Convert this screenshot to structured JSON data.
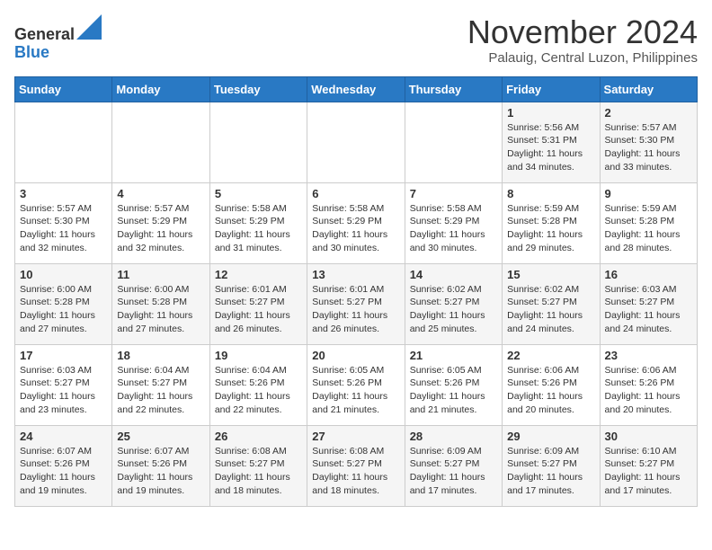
{
  "header": {
    "logo_line1": "General",
    "logo_line2": "Blue",
    "month_title": "November 2024",
    "location": "Palauig, Central Luzon, Philippines"
  },
  "weekdays": [
    "Sunday",
    "Monday",
    "Tuesday",
    "Wednesday",
    "Thursday",
    "Friday",
    "Saturday"
  ],
  "weeks": [
    [
      {
        "day": "",
        "info": ""
      },
      {
        "day": "",
        "info": ""
      },
      {
        "day": "",
        "info": ""
      },
      {
        "day": "",
        "info": ""
      },
      {
        "day": "",
        "info": ""
      },
      {
        "day": "1",
        "info": "Sunrise: 5:56 AM\nSunset: 5:31 PM\nDaylight: 11 hours and 34 minutes."
      },
      {
        "day": "2",
        "info": "Sunrise: 5:57 AM\nSunset: 5:30 PM\nDaylight: 11 hours and 33 minutes."
      }
    ],
    [
      {
        "day": "3",
        "info": "Sunrise: 5:57 AM\nSunset: 5:30 PM\nDaylight: 11 hours and 32 minutes."
      },
      {
        "day": "4",
        "info": "Sunrise: 5:57 AM\nSunset: 5:29 PM\nDaylight: 11 hours and 32 minutes."
      },
      {
        "day": "5",
        "info": "Sunrise: 5:58 AM\nSunset: 5:29 PM\nDaylight: 11 hours and 31 minutes."
      },
      {
        "day": "6",
        "info": "Sunrise: 5:58 AM\nSunset: 5:29 PM\nDaylight: 11 hours and 30 minutes."
      },
      {
        "day": "7",
        "info": "Sunrise: 5:58 AM\nSunset: 5:29 PM\nDaylight: 11 hours and 30 minutes."
      },
      {
        "day": "8",
        "info": "Sunrise: 5:59 AM\nSunset: 5:28 PM\nDaylight: 11 hours and 29 minutes."
      },
      {
        "day": "9",
        "info": "Sunrise: 5:59 AM\nSunset: 5:28 PM\nDaylight: 11 hours and 28 minutes."
      }
    ],
    [
      {
        "day": "10",
        "info": "Sunrise: 6:00 AM\nSunset: 5:28 PM\nDaylight: 11 hours and 27 minutes."
      },
      {
        "day": "11",
        "info": "Sunrise: 6:00 AM\nSunset: 5:28 PM\nDaylight: 11 hours and 27 minutes."
      },
      {
        "day": "12",
        "info": "Sunrise: 6:01 AM\nSunset: 5:27 PM\nDaylight: 11 hours and 26 minutes."
      },
      {
        "day": "13",
        "info": "Sunrise: 6:01 AM\nSunset: 5:27 PM\nDaylight: 11 hours and 26 minutes."
      },
      {
        "day": "14",
        "info": "Sunrise: 6:02 AM\nSunset: 5:27 PM\nDaylight: 11 hours and 25 minutes."
      },
      {
        "day": "15",
        "info": "Sunrise: 6:02 AM\nSunset: 5:27 PM\nDaylight: 11 hours and 24 minutes."
      },
      {
        "day": "16",
        "info": "Sunrise: 6:03 AM\nSunset: 5:27 PM\nDaylight: 11 hours and 24 minutes."
      }
    ],
    [
      {
        "day": "17",
        "info": "Sunrise: 6:03 AM\nSunset: 5:27 PM\nDaylight: 11 hours and 23 minutes."
      },
      {
        "day": "18",
        "info": "Sunrise: 6:04 AM\nSunset: 5:27 PM\nDaylight: 11 hours and 22 minutes."
      },
      {
        "day": "19",
        "info": "Sunrise: 6:04 AM\nSunset: 5:26 PM\nDaylight: 11 hours and 22 minutes."
      },
      {
        "day": "20",
        "info": "Sunrise: 6:05 AM\nSunset: 5:26 PM\nDaylight: 11 hours and 21 minutes."
      },
      {
        "day": "21",
        "info": "Sunrise: 6:05 AM\nSunset: 5:26 PM\nDaylight: 11 hours and 21 minutes."
      },
      {
        "day": "22",
        "info": "Sunrise: 6:06 AM\nSunset: 5:26 PM\nDaylight: 11 hours and 20 minutes."
      },
      {
        "day": "23",
        "info": "Sunrise: 6:06 AM\nSunset: 5:26 PM\nDaylight: 11 hours and 20 minutes."
      }
    ],
    [
      {
        "day": "24",
        "info": "Sunrise: 6:07 AM\nSunset: 5:26 PM\nDaylight: 11 hours and 19 minutes."
      },
      {
        "day": "25",
        "info": "Sunrise: 6:07 AM\nSunset: 5:26 PM\nDaylight: 11 hours and 19 minutes."
      },
      {
        "day": "26",
        "info": "Sunrise: 6:08 AM\nSunset: 5:27 PM\nDaylight: 11 hours and 18 minutes."
      },
      {
        "day": "27",
        "info": "Sunrise: 6:08 AM\nSunset: 5:27 PM\nDaylight: 11 hours and 18 minutes."
      },
      {
        "day": "28",
        "info": "Sunrise: 6:09 AM\nSunset: 5:27 PM\nDaylight: 11 hours and 17 minutes."
      },
      {
        "day": "29",
        "info": "Sunrise: 6:09 AM\nSunset: 5:27 PM\nDaylight: 11 hours and 17 minutes."
      },
      {
        "day": "30",
        "info": "Sunrise: 6:10 AM\nSunset: 5:27 PM\nDaylight: 11 hours and 17 minutes."
      }
    ]
  ]
}
